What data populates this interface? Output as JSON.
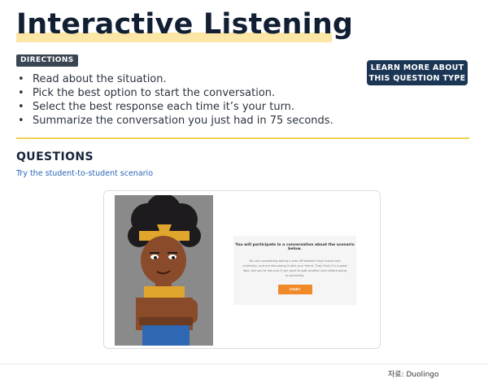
{
  "title": "Interactive Listening",
  "directions": {
    "badge": "DIRECTIONS",
    "items": [
      "Read about the situation.",
      "Pick the best option to start the conversation.",
      "Select the best response each time it’s your turn.",
      "Summarize the conversation you just had in 75 seconds."
    ]
  },
  "learn_more": {
    "line1": "LEARN MORE ABOUT",
    "line2": "THIS QUESTION TYPE"
  },
  "questions": {
    "heading": "QUESTIONS",
    "link": "Try the student-to-student scenario"
  },
  "preview": {
    "heading": "You will participate in a conversation about the scenario below.",
    "body": "You are considering taking a year off between high school and university, and are discussing it with your friend. They think it’s a great idea, but you’re not sure if you want to wait another year before going to university.",
    "start_label": "START"
  },
  "source": "자료: Duolingo",
  "colors": {
    "title": "#121f33",
    "highlight": "#fce6a6",
    "divider": "#f2cf55",
    "button": "#1b3555",
    "link": "#2a66b6",
    "start": "#f08a28"
  }
}
